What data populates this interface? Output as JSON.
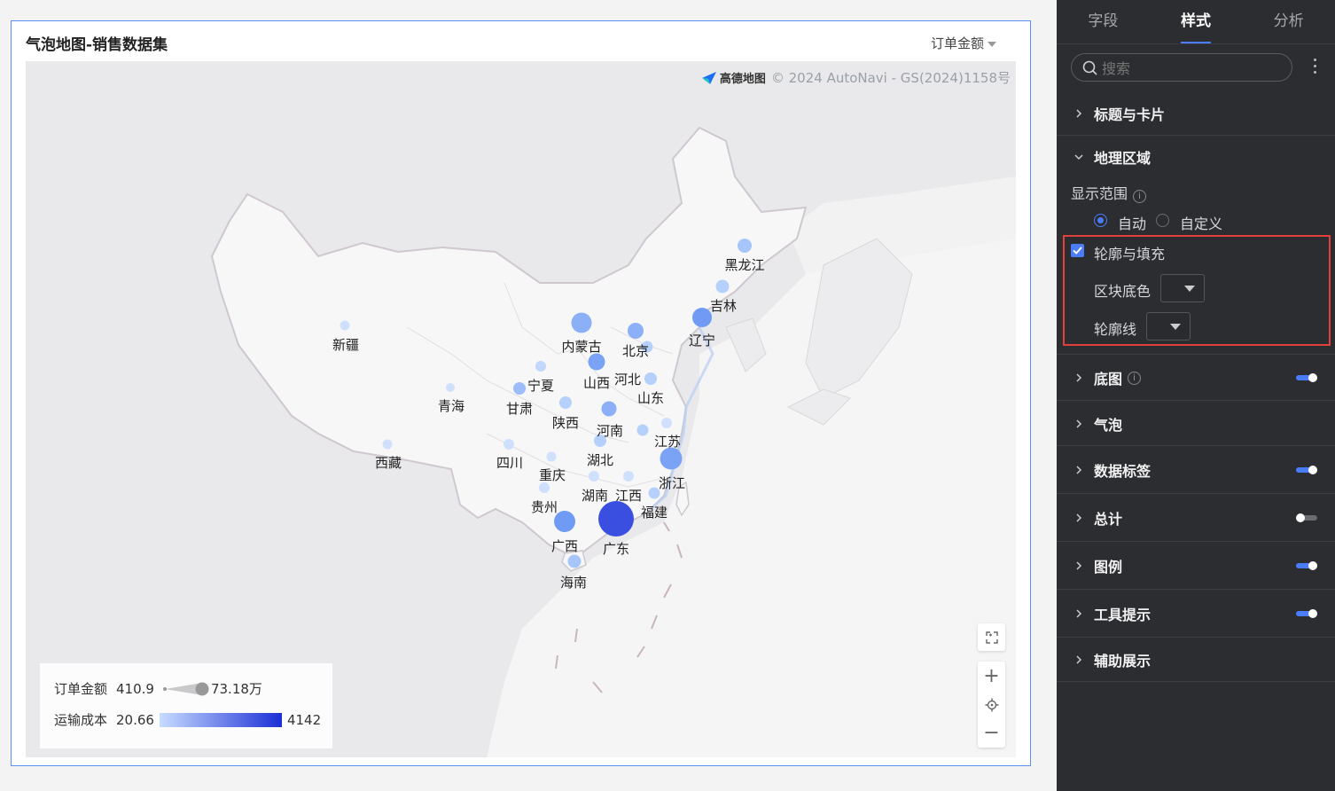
{
  "chart_card": {
    "title": "气泡地图-销售数据集",
    "measure_dropdown": "订单金额",
    "attribution_logo": "高德地图",
    "attribution_text": "© 2024 AutoNavi - GS(2024)1158号"
  },
  "legend": {
    "size_label": "订单金额",
    "size_min": "410.9",
    "size_max": "73.18万",
    "color_label": "运输成本",
    "color_min": "20.66",
    "color_max": "4142"
  },
  "map_controls": {
    "expand_icon": "expand-icon",
    "zoom_in": "+",
    "locate_icon": "locate-icon",
    "zoom_out": "−"
  },
  "chart_data": {
    "type": "bubble-map",
    "size_measure": "订单金额",
    "color_measure": "运输成本",
    "regions": [
      "黑龙江",
      "吉林",
      "辽宁",
      "内蒙古",
      "北京",
      "新疆",
      "宁夏",
      "山西",
      "河北",
      "青海",
      "甘肃",
      "山东",
      "陕西",
      "河南",
      "江苏",
      "西藏",
      "四川",
      "湖北",
      "重庆",
      "浙江",
      "贵州",
      "湖南",
      "江西",
      "福建",
      "广西",
      "广东",
      "海南"
    ]
  },
  "panel": {
    "tabs": [
      {
        "label": "字段"
      },
      {
        "label": "样式"
      },
      {
        "label": "分析"
      }
    ],
    "search_placeholder": "搜索",
    "sections": {
      "title_card": "标题与卡片",
      "geo_region": "地理区域",
      "display_range": "显示范围",
      "radio_auto": "自动",
      "radio_custom": "自定义",
      "outline_fill": "轮廓与填充",
      "block_color": "区块底色",
      "outline_line": "轮廓线",
      "basemap": "底图",
      "bubble": "气泡",
      "data_label": "数据标签",
      "total": "总计",
      "legend": "图例",
      "tooltip": "工具提示",
      "aux_display": "辅助展示"
    },
    "toggles": {
      "basemap": true,
      "data_label": true,
      "total": false,
      "legend": true,
      "tooltip": true
    },
    "colors": {
      "accent": "#4b7dfb",
      "highlight": "#e0413b",
      "panel_bg": "#2c2d31"
    }
  }
}
